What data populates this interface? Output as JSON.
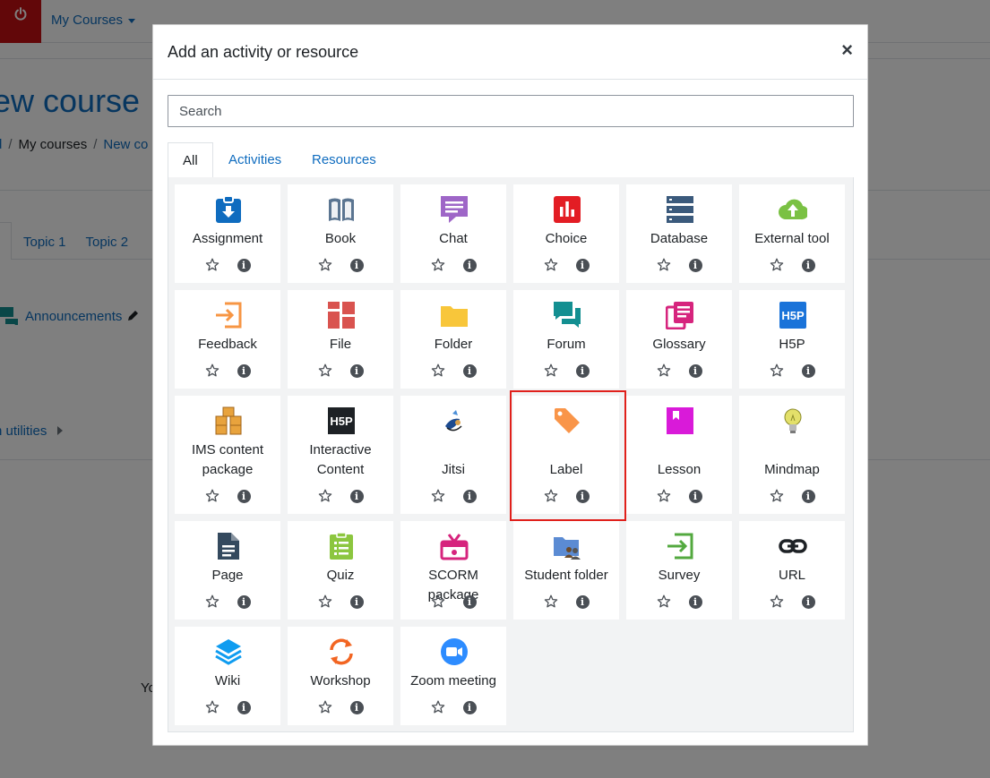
{
  "background": {
    "navbar": {
      "my_courses": "My Courses"
    },
    "page_title": "ew course",
    "breadcrumb": {
      "item1": "d",
      "sep": "/",
      "item2": "My courses",
      "item3": "New co"
    },
    "tabs": [
      "Topic 1",
      "Topic 2"
    ],
    "announcements": "Announcements",
    "utilities": "n utilities",
    "partial_text": "Yo"
  },
  "modal": {
    "title": "Add an activity or resource",
    "close_symbol": "×",
    "search_placeholder": "Search",
    "tabs": {
      "all": "All",
      "activities": "Activities",
      "resources": "Resources"
    },
    "items": [
      {
        "name": "Assignment",
        "icon": "assignment-icon",
        "color": "#0f6cbf"
      },
      {
        "name": "Book",
        "icon": "book-icon",
        "color": "#5b7591"
      },
      {
        "name": "Chat",
        "icon": "chat-icon",
        "color": "#9e66c7"
      },
      {
        "name": "Choice",
        "icon": "choice-icon",
        "color": "#e31d24"
      },
      {
        "name": "Database",
        "icon": "database-icon",
        "color": "#3b5a7c"
      },
      {
        "name": "External tool",
        "icon": "external-tool-icon",
        "color": "#7ac143"
      },
      {
        "name": "Feedback",
        "icon": "feedback-icon",
        "color": "#f79644"
      },
      {
        "name": "File",
        "icon": "file-icon",
        "color": "#d9534f"
      },
      {
        "name": "Folder",
        "icon": "folder-icon",
        "color": "#f8c63a"
      },
      {
        "name": "Forum",
        "icon": "forum-icon",
        "color": "#138f91"
      },
      {
        "name": "Glossary",
        "icon": "glossary-icon",
        "color": "#d6247d"
      },
      {
        "name": "H5P",
        "icon": "h5p-icon",
        "color": "#1a73d9"
      },
      {
        "name": "IMS content package",
        "icon": "ims-package-icon",
        "color": "#e8a33d"
      },
      {
        "name": "Interactive Content",
        "icon": "interactive-content-icon",
        "color": "#1d2125"
      },
      {
        "name": "Jitsi",
        "icon": "jitsi-icon",
        "color": "#1d4b8f"
      },
      {
        "name": "Label",
        "icon": "label-icon",
        "color": "#f99549"
      },
      {
        "name": "Lesson",
        "icon": "lesson-icon",
        "color": "#d91ad9"
      },
      {
        "name": "Mindmap",
        "icon": "mindmap-icon",
        "color": "#e3e06a"
      },
      {
        "name": "Page",
        "icon": "page-icon",
        "color": "#34495e"
      },
      {
        "name": "Quiz",
        "icon": "quiz-icon",
        "color": "#8cc63f"
      },
      {
        "name": "SCORM package",
        "icon": "scorm-icon",
        "color": "#d6247d"
      },
      {
        "name": "Student folder",
        "icon": "student-folder-icon",
        "color": "#5b8bd3"
      },
      {
        "name": "Survey",
        "icon": "survey-icon",
        "color": "#53a93f"
      },
      {
        "name": "URL",
        "icon": "url-icon",
        "color": "#1d2125"
      },
      {
        "name": "Wiki",
        "icon": "wiki-icon",
        "color": "#0f9cf0"
      },
      {
        "name": "Workshop",
        "icon": "workshop-icon",
        "color": "#f26522"
      },
      {
        "name": "Zoom meeting",
        "icon": "zoom-icon",
        "color": "#2d8cff"
      }
    ],
    "highlighted_item": "Label",
    "highlight_color": "#e0201b"
  }
}
